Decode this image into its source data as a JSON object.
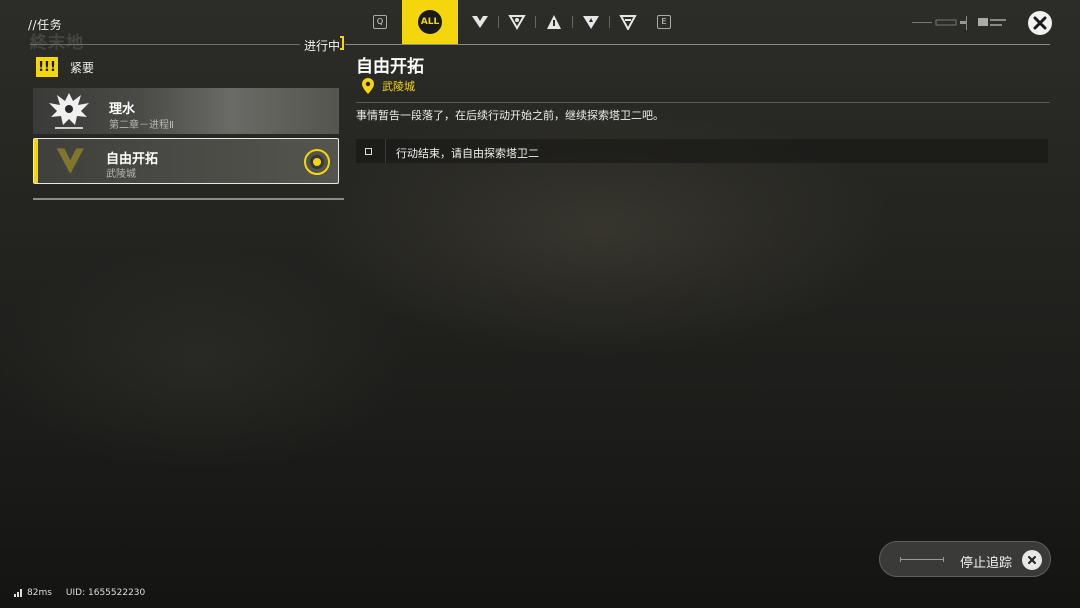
{
  "header": {
    "page_title": "//任务",
    "deco_text": "終末地",
    "status": "进行中"
  },
  "tabs": {
    "prev_key": "Q",
    "all_label": "ALL",
    "next_key": "E",
    "categories": [
      "main-quest-icon",
      "side-quest-icon",
      "exploration-icon",
      "event-icon",
      "daily-icon"
    ]
  },
  "quest_list": {
    "group_icon": "!!!",
    "group_label": "紧要",
    "items": [
      {
        "name": "理水",
        "sub": "第二章－进程Ⅱ"
      },
      {
        "name": "自由开拓",
        "sub": "武陵城",
        "tracked": true
      }
    ]
  },
  "detail": {
    "title": "自由开拓",
    "location": "武陵城",
    "description": "事情暂告一段落了，在后续行动开始之前，继续探索塔卫二吧。",
    "objective": "行动结束，请自由探索塔卫二"
  },
  "stop_tracking": {
    "label": "停止追踪"
  },
  "footer": {
    "ping": "82ms",
    "uid": "UID: 1655522230"
  },
  "colors": {
    "accent": "#f3d60b"
  }
}
